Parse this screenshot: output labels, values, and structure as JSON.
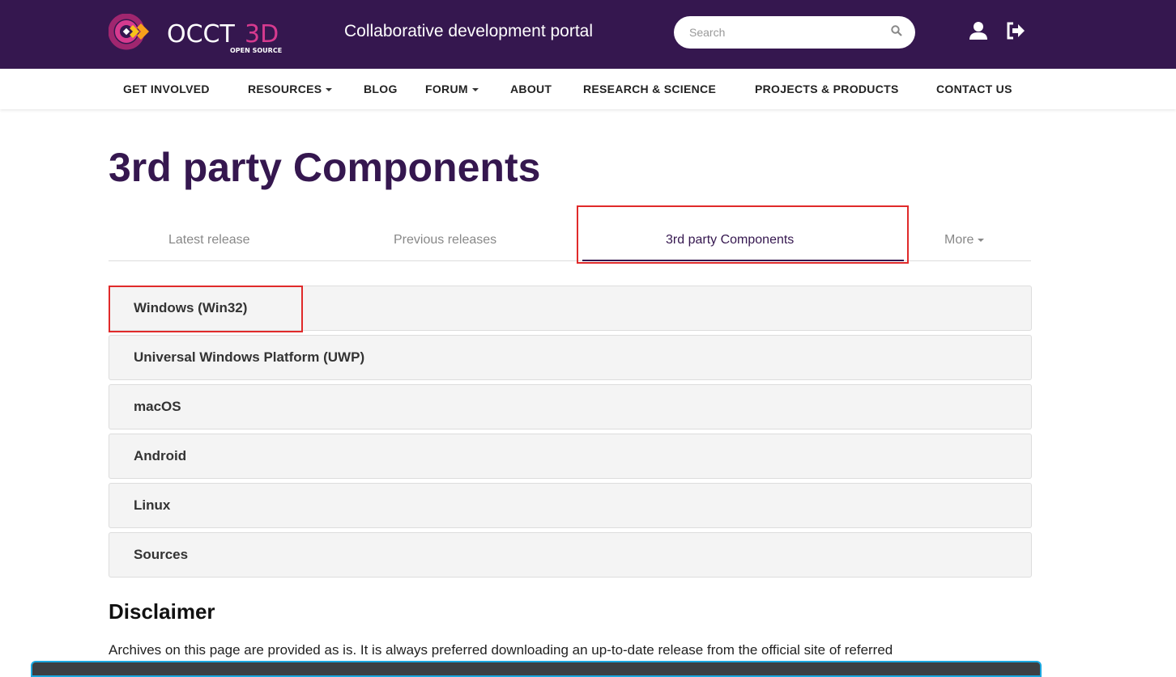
{
  "header": {
    "logo_text": "OCCT3D",
    "logo_subtext": "OPEN SOURCE",
    "tagline": "Collaborative development portal",
    "search_placeholder": "Search",
    "colors": {
      "bg": "#35174f",
      "accent_pink": "#d63a8f",
      "accent_orange": "#f7a11a"
    }
  },
  "nav": {
    "items": [
      {
        "label": "GET INVOLVED"
      },
      {
        "label": "RESOURCES"
      },
      {
        "label": "BLOG"
      },
      {
        "label": "FORUM"
      },
      {
        "label": "ABOUT"
      },
      {
        "label": "RESEARCH & SCIENCE"
      },
      {
        "label": "PROJECTS & PRODUCTS"
      },
      {
        "label": "CONTACT US"
      }
    ]
  },
  "page": {
    "title": "3rd party Components",
    "tabs": [
      {
        "label": "Latest release"
      },
      {
        "label": "Previous releases"
      },
      {
        "label": "3rd party Components",
        "active": true
      },
      {
        "label": "More"
      }
    ],
    "panels": [
      {
        "label": "Windows (Win32)"
      },
      {
        "label": "Universal Windows Platform (UWP)"
      },
      {
        "label": "macOS"
      },
      {
        "label": "Android"
      },
      {
        "label": "Linux"
      },
      {
        "label": "Sources"
      }
    ],
    "disclaimer_title": "Disclaimer",
    "disclaimer_text": "Archives on this page are provided as is. It is always preferred downloading an up-to-date release from the official site of referred"
  }
}
